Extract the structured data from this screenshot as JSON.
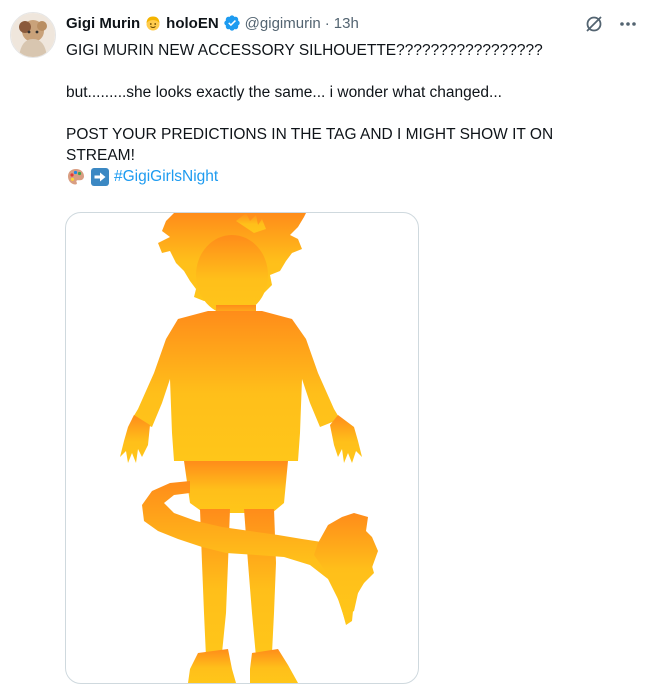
{
  "author": {
    "display_name": "Gigi Murin",
    "org_label": "holoEN",
    "handle": "@gigimurin",
    "separator": "·",
    "timestamp": "13h"
  },
  "tweet": {
    "line1": "GIGI MURIN NEW ACCESSORY SILHOUETTE?????????????????",
    "line2": "but.........she looks exactly the same... i wonder what changed...",
    "line3": "POST YOUR PREDICTIONS IN THE TAG AND I MIGHT SHOW IT ON STREAM!",
    "hashtag": "#GigiGirlsNight"
  },
  "icons": {
    "name_emoji": "blonde-person-emoji",
    "verified": "verified-badge-icon",
    "grok": "grok-icon",
    "more": "more-icon",
    "palette": "palette-emoji",
    "arrow": "right-arrow-emoji"
  },
  "colors": {
    "link": "#1d9bf0",
    "verified": "#1d9bf0",
    "secondary_text": "#536471",
    "silhouette_top": "#ff8c1a",
    "silhouette_bottom": "#ffc619"
  }
}
